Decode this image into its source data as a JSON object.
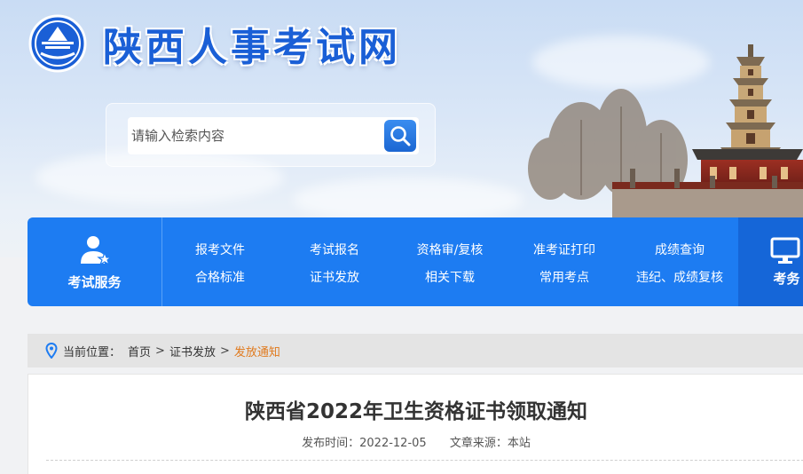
{
  "header": {
    "site_title": "陕西人事考试网",
    "search_placeholder": "请输入检索内容"
  },
  "nav": {
    "service_label": "考试服务",
    "links": [
      "报考文件",
      "考试报名",
      "资格审/复核",
      "准考证打印",
      "成绩查询",
      "合格标准",
      "证书发放",
      "相关下载",
      "常用考点",
      "违纪、成绩复核"
    ],
    "right_label": "考务"
  },
  "breadcrumb": {
    "prefix": "当前位置：",
    "items": [
      "首页",
      "证书发放",
      "发放通知"
    ],
    "separator": ">"
  },
  "article": {
    "title": "陕西省2022年卫生资格证书领取通知",
    "publish_time": "发布时间：2022-12-05",
    "source": "文章来源：本站"
  },
  "colors": {
    "brand_blue": "#1d7cf2",
    "title_blue": "#1a5fd6",
    "breadcrumb_current": "#e07a1e"
  },
  "icons": [
    "logo-icon",
    "search-icon",
    "user-star-icon",
    "monitor-icon",
    "location-pin-icon"
  ]
}
